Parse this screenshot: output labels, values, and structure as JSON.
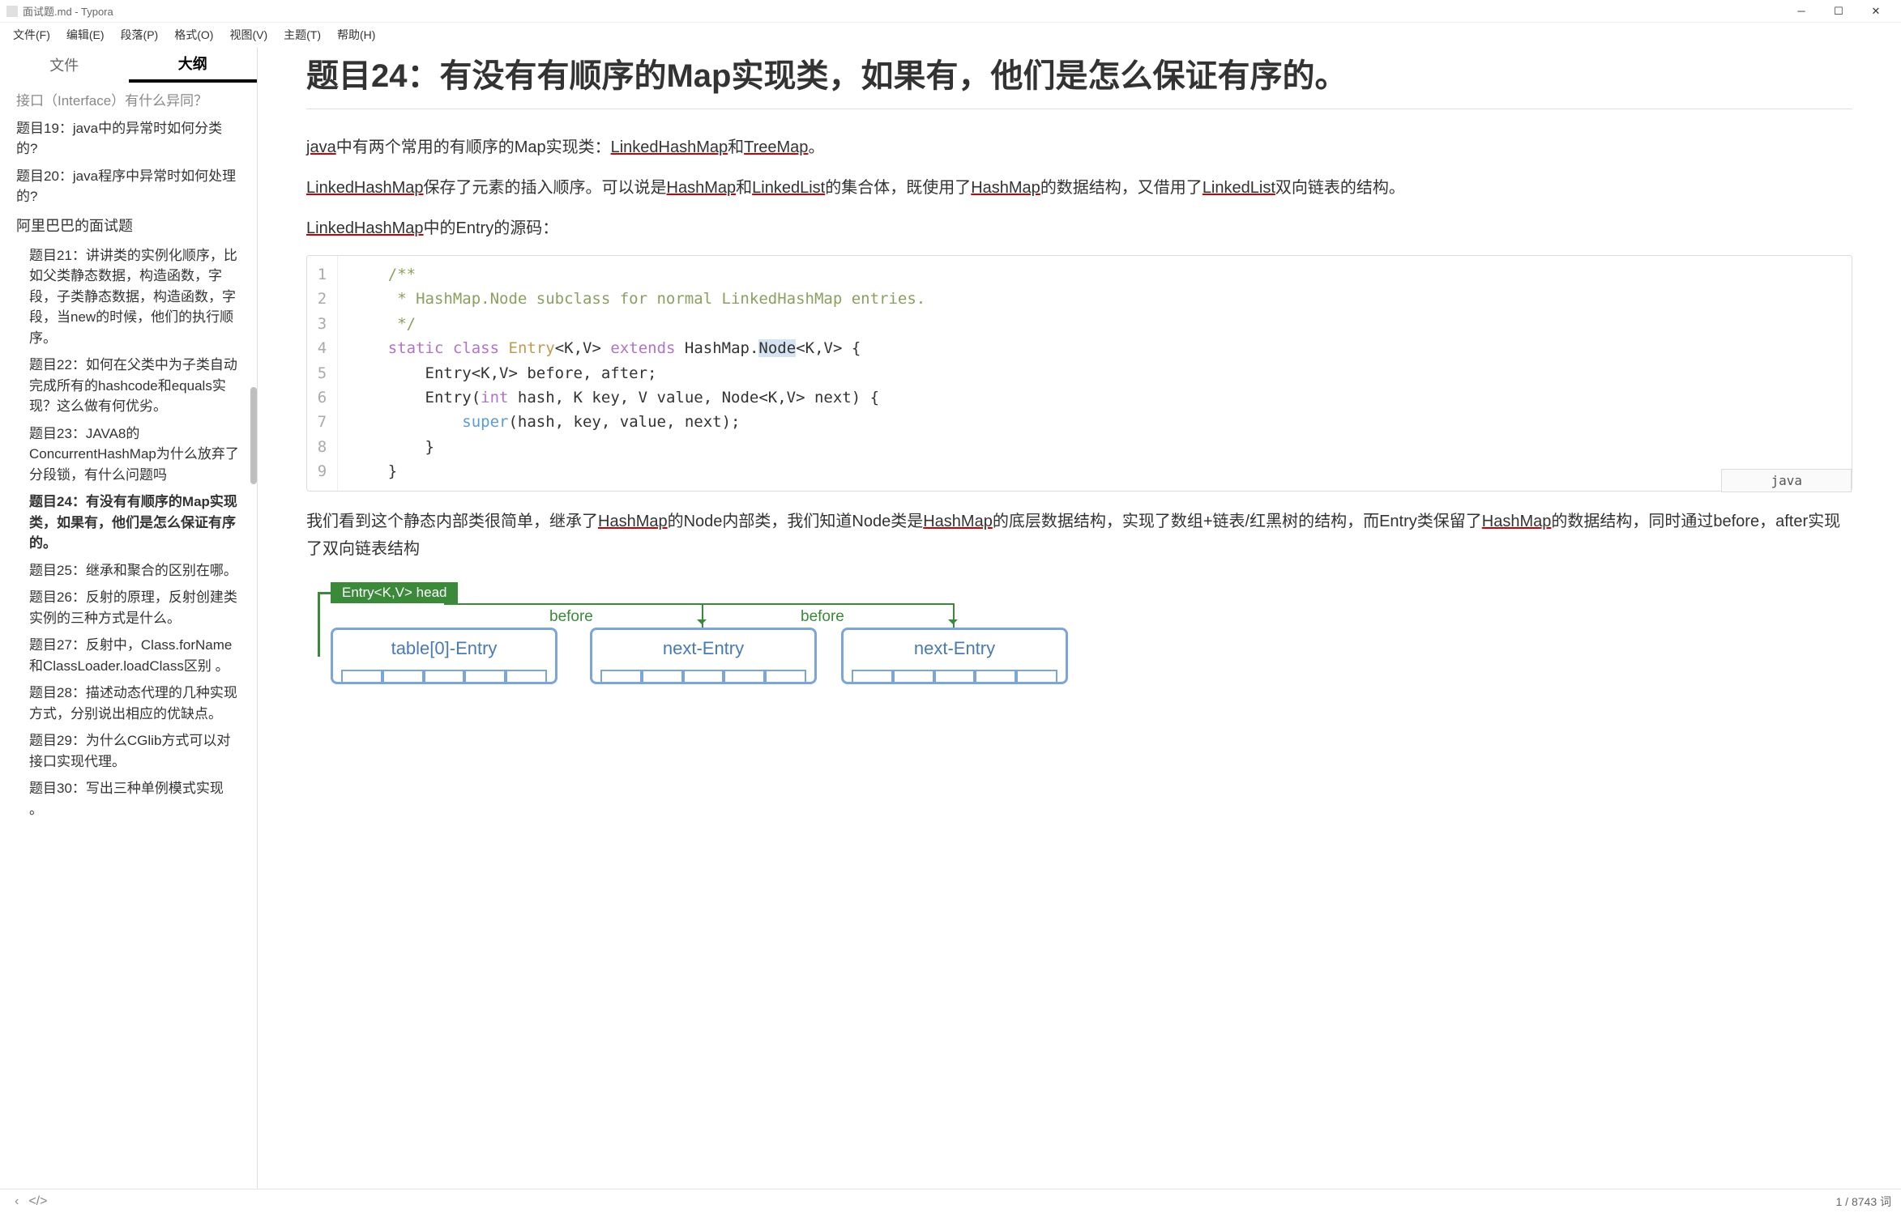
{
  "window": {
    "title": "面试题.md - Typora"
  },
  "menu": {
    "file": "文件(F)",
    "edit": "编辑(E)",
    "paragraph": "段落(P)",
    "format": "格式(O)",
    "view": "视图(V)",
    "theme": "主题(T)",
    "help": "帮助(H)"
  },
  "tabs": {
    "file": "文件",
    "outline": "大纲"
  },
  "outline": {
    "truncated": "接口（Interface）有什么异同？",
    "i19": "题目19：java中的异常时如何分类的?",
    "i20": "题目20：java程序中异常时如何处理的?",
    "header": "阿里巴巴的面试题",
    "i21": "题目21：讲讲类的实例化顺序，比如父类静态数据，构造函数，字段，子类静态数据，构造函数，字段，当new的时候，他们的执行顺序。",
    "i22": "题目22：如何在父类中为子类自动完成所有的hashcode和equals实现？这么做有何优劣。",
    "i23": "题目23：JAVA8的ConcurrentHashMap为什么放弃了分段锁，有什么问题吗",
    "i24": "题目24：有没有有顺序的Map实现类，如果有，他们是怎么保证有序的。",
    "i25": "题目25：继承和聚合的区别在哪。",
    "i26": "题目26：反射的原理，反射创建类实例的三种方式是什么。",
    "i27": "题目27：反射中，Class.forName和ClassLoader.loadClass区别 。",
    "i28": "题目28：描述动态代理的几种实现方式，分别说出相应的优缺点。",
    "i29": "题目29：为什么CGlib方式可以对接口实现代理。",
    "i30": "题目30：写出三种单例模式实现 。"
  },
  "article": {
    "heading": "题目24：有没有有顺序的Map实现类，如果有，他们是怎么保证有序的。",
    "p1_a": "java",
    "p1_b": "中有两个常用的有顺序的Map实现类：",
    "p1_c": "LinkedHashMap",
    "p1_d": "和",
    "p1_e": "TreeMap",
    "p1_f": "。",
    "p2_a": "LinkedHashMap",
    "p2_b": "保存了元素的插入顺序。可以说是",
    "p2_c": "HashMap",
    "p2_d": "和",
    "p2_e": "LinkedList",
    "p2_f": "的集合体，既使用了",
    "p2_g": "HashMap",
    "p2_h": "的数据结构，又借用了",
    "p2_i": "LinkedList",
    "p2_j": "双向链表的结构。",
    "p3_a": "LinkedHashMap",
    "p3_b": "中的Entry的源码：",
    "p4_a": "我们看到这个静态内部类很简单，继承了",
    "p4_b": "HashMap",
    "p4_c": "的Node内部类，我们知道Node类是",
    "p4_d": "HashMap",
    "p4_e": "的底层数据结构，实现了数组+链表/红黑树的结构，而Entry类保留了",
    "p4_f": "HashMap",
    "p4_g": "的数据结构，同时通过before，after实现了双向链表结构"
  },
  "code": {
    "lang": "java",
    "l1_a": "    /**",
    "l2_a": "     * HashMap.Node subclass for normal LinkedHashMap entries.",
    "l3_a": "     */",
    "l4_kw1": "static",
    "l4_kw2": "class",
    "l4_ty": "Entry",
    "l4_gen": "<K,V>",
    "l4_kw3": "extends",
    "l4_sup": "HashMap.",
    "l4_node": "Node",
    "l4_rest": "<K,V> {",
    "l5": "        Entry<K,V> before, after;",
    "l6_a": "        Entry(",
    "l6_int": "int",
    "l6_b": " hash, K key, V value, Node<K,V> next) {",
    "l7_a": "            ",
    "l7_super": "super",
    "l7_b": "(hash, key, value, next);",
    "l8": "        }",
    "l9": "    }"
  },
  "diagram": {
    "head": "Entry<K,V> head",
    "before": "before",
    "n1": "table[0]-Entry",
    "n2": "next-Entry",
    "n3": "next-Entry"
  },
  "status": {
    "wordcount": "1 / 8743 词"
  }
}
